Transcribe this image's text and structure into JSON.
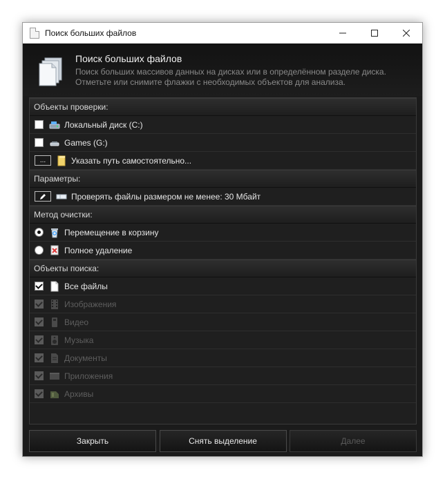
{
  "window": {
    "title": "Поиск больших файлов",
    "minimize": "—",
    "maximize": "☐",
    "close": "✕"
  },
  "header": {
    "title": "Поиск больших файлов",
    "description": "Поиск больших массивов данных на дисках или в определённом разделе диска. Отметьте или снимите флажки с необходимых объектов для анализа."
  },
  "sections": {
    "check_objects": "Объекты проверки:",
    "parameters": "Параметры:",
    "cleanup_method": "Метод очистки:",
    "search_objects": "Объекты поиска:"
  },
  "drives": [
    {
      "label": "Локальный диск (C:)",
      "checked": false,
      "icon": "drive-icon"
    },
    {
      "label": "Games (G:)",
      "checked": false,
      "icon": "removable-drive-icon"
    }
  ],
  "custom_path": {
    "button": "...",
    "label": "Указать путь самостоятельно...",
    "icon": "folder-icon"
  },
  "parameter_row": {
    "label": "Проверять файлы размером не менее: 30 Мбайт",
    "icon": "pencil-icon"
  },
  "methods": [
    {
      "label": "Перемещение в корзину",
      "selected": true,
      "icon": "recycle-bin-icon"
    },
    {
      "label": "Полное удаление",
      "selected": false,
      "icon": "shred-icon"
    }
  ],
  "search_types": [
    {
      "label": "Все файлы",
      "checked": true,
      "enabled": true,
      "icon": "file-icon"
    },
    {
      "label": "Изображения",
      "checked": true,
      "enabled": false,
      "icon": "film-icon"
    },
    {
      "label": "Видео",
      "checked": true,
      "enabled": false,
      "icon": "video-icon"
    },
    {
      "label": "Музыка",
      "checked": true,
      "enabled": false,
      "icon": "speaker-icon"
    },
    {
      "label": "Документы",
      "checked": true,
      "enabled": false,
      "icon": "document-icon"
    },
    {
      "label": "Приложения",
      "checked": true,
      "enabled": false,
      "icon": "application-icon"
    },
    {
      "label": "Архивы",
      "checked": true,
      "enabled": false,
      "icon": "archive-icon"
    }
  ],
  "footer": {
    "close": "Закрыть",
    "deselect": "Снять выделение",
    "next": "Далее"
  },
  "colors": {
    "background": "#1b1b1b",
    "text": "#e6e6e6",
    "disabled_text": "#5e5e5e",
    "section_text": "#d8d8d8",
    "muted_text": "#8a8a8a"
  }
}
